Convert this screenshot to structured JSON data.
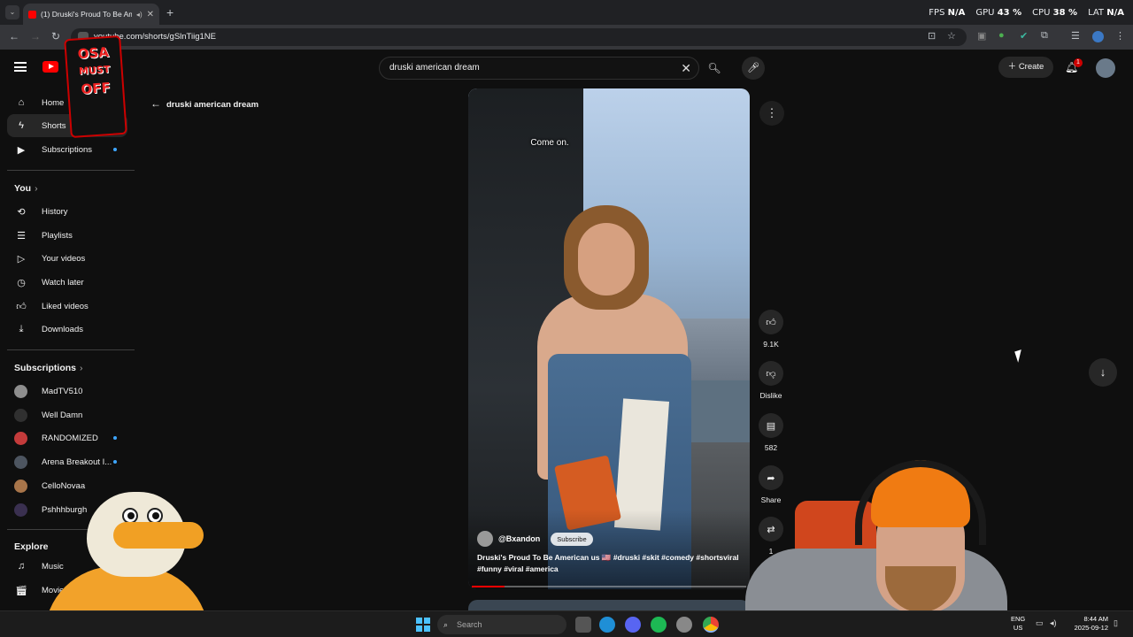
{
  "browser": {
    "tab_title": "(1) Druski's Proud To Be Am",
    "new_tab": "+",
    "url": "youtube.com/shorts/gSlnTiig1NE",
    "stats": {
      "fps_label": "FPS",
      "fps_value": "N/A",
      "gpu_label": "GPU",
      "gpu_value": "43 %",
      "cpu_label": "CPU",
      "cpu_value": "38 %",
      "lat_label": "LAT",
      "lat_value": "N/A"
    }
  },
  "header": {
    "search_query": "druski american dream",
    "create_label": "Create",
    "notification_count": "1",
    "overlay_logo_lines": [
      "OSA",
      "MUST",
      "OFF"
    ]
  },
  "sidebar": {
    "main_items": [
      {
        "label": "Home",
        "icon": "home-icon"
      },
      {
        "label": "Shorts",
        "icon": "shorts-icon"
      },
      {
        "label": "Subscriptions",
        "icon": "subscriptions-icon"
      }
    ],
    "you_heading": "You",
    "you_items": [
      {
        "label": "History",
        "icon": "history-icon"
      },
      {
        "label": "Playlists",
        "icon": "playlists-icon"
      },
      {
        "label": "Your videos",
        "icon": "your-videos-icon"
      },
      {
        "label": "Watch later",
        "icon": "watch-later-icon"
      },
      {
        "label": "Liked videos",
        "icon": "liked-videos-icon"
      },
      {
        "label": "Downloads",
        "icon": "downloads-icon"
      }
    ],
    "subs_heading": "Subscriptions",
    "subscriptions": [
      {
        "label": "MadTV510",
        "color": "#8e8e8e",
        "new": false
      },
      {
        "label": "Well Damn",
        "color": "#303030",
        "new": false
      },
      {
        "label": "RANDOMIZED",
        "color": "#c43b3b",
        "new": true
      },
      {
        "label": "Arena Breakout I...",
        "color": "#4d5560",
        "new": true
      },
      {
        "label": "CelloNovaa",
        "color": "#a8754a",
        "new": false
      },
      {
        "label": "Pshhhburgh",
        "color": "#3a3050",
        "new": false
      }
    ],
    "explore_heading": "Explore",
    "explore_items": [
      {
        "label": "Music",
        "icon": "music-icon"
      },
      {
        "label": "Movies & TV",
        "icon": "movies-icon"
      }
    ]
  },
  "back_label": "druski american dream",
  "short": {
    "caption": "Come on.",
    "channel": "@Bxandon",
    "subscribe_label": "Subscribe",
    "description": "Druski's Proud To Be American us 🇺🇸 #druski #skit #comedy #shortsviral #funny #viral #america",
    "progress_fraction": 0.12
  },
  "actions": {
    "likes": "9.1K",
    "dislike_label": "Dislike",
    "comments": "582",
    "share_label": "Share",
    "remix_count": "1"
  },
  "taskbar": {
    "search_placeholder": "Search",
    "lang_line1": "ENG",
    "lang_line2": "US",
    "time": "8:44 AM",
    "date": "2025-09-12"
  },
  "colors": {
    "accent": "#ff0000",
    "badge": "#cc0000",
    "unread_dot": "#3ea6ff"
  }
}
